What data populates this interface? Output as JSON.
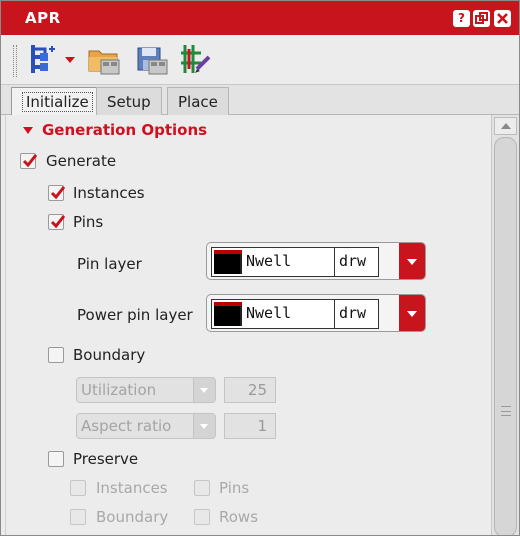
{
  "window": {
    "title": "APR",
    "accent_color": "#c8141c",
    "controls": [
      "help-icon",
      "float-icon",
      "close-icon"
    ]
  },
  "toolbar": {
    "tools": [
      "run-generate-icon",
      "open-folder-icon",
      "save-template-icon",
      "edit-layout-icon"
    ]
  },
  "tabs": [
    {
      "label": "Initialize",
      "active": true
    },
    {
      "label": "Setup",
      "active": false
    },
    {
      "label": "Place",
      "active": false
    }
  ],
  "generation": {
    "section_title": "Generation Options",
    "generate": {
      "label": "Generate",
      "checked": true
    },
    "instances": {
      "label": "Instances",
      "checked": true
    },
    "pins": {
      "label": "Pins",
      "checked": true
    },
    "pin_layer": {
      "label": "Pin layer",
      "name": "Nwell",
      "purpose": "drw"
    },
    "power_pin_layer": {
      "label": "Power pin layer",
      "name": "Nwell",
      "purpose": "drw"
    },
    "boundary": {
      "label": "Boundary",
      "checked": false
    },
    "utilization": {
      "selected": "Utilization",
      "value": "25",
      "enabled": false
    },
    "aspect_ratio": {
      "selected": "Aspect ratio",
      "value": "1",
      "enabled": false
    },
    "preserve": {
      "label": "Preserve",
      "checked": false,
      "instances_label": "Instances",
      "pins_label": "Pins",
      "boundary_label": "Boundary",
      "rows_label": "Rows"
    }
  }
}
